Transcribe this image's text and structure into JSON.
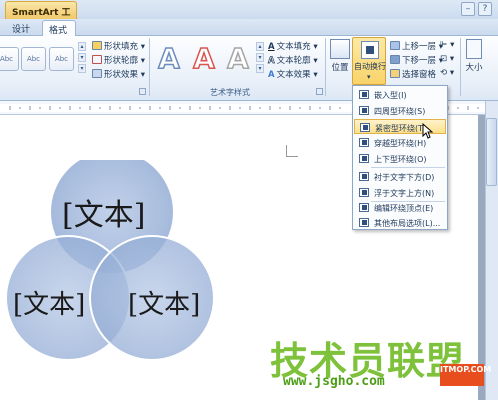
{
  "titlebar": {
    "context_tab": "SmartArt 工具"
  },
  "tabs": [
    {
      "label": "设计"
    },
    {
      "label": "格式"
    }
  ],
  "shape_styles": {
    "thumb_label": "Abc"
  },
  "shape_menu": [
    {
      "label": "形状填充",
      "arrow": "▾"
    },
    {
      "label": "形状轮廓",
      "arrow": "▾"
    },
    {
      "label": "形状效果",
      "arrow": "▾"
    }
  ],
  "wordart": {
    "glyph": "A",
    "group_label": "艺术字样式",
    "menu": [
      {
        "label": "文本填充",
        "arrow": "▾"
      },
      {
        "label": "文本轮廓",
        "arrow": "▾"
      },
      {
        "label": "文本效果",
        "arrow": "▾"
      }
    ]
  },
  "arrange": {
    "position_label": "位置",
    "wrap_label": "自动换行",
    "bring_forward": "上移一层",
    "send_backward": "下移一层",
    "selection_pane": "选择窗格",
    "size_label": "大小"
  },
  "wrap_menu": [
    {
      "label": "嵌入型(I)"
    },
    {
      "label": "四周型环绕(S)"
    },
    {
      "label": "紧密型环绕(T)"
    },
    {
      "label": "穿越型环绕(H)"
    },
    {
      "label": "上下型环绕(O)"
    },
    {
      "label": "衬于文字下方(D)"
    },
    {
      "label": "浮于文字上方(N)"
    },
    {
      "label": "编辑环绕顶点(E)"
    },
    {
      "label": "其他布局选项(L)..."
    }
  ],
  "venn": {
    "labels": [
      "[文本]",
      "[文本]",
      "[文本]"
    ]
  },
  "watermark": {
    "brand": "技术员联盟",
    "url": "www.jsgho.com",
    "badge": "ITMOP.COM"
  },
  "icons": [
    "close-icon",
    "minimize-icon",
    "help-icon",
    "text-fill-icon",
    "text-outline-icon",
    "text-effect-icon",
    "position-icon",
    "wrap-text-icon",
    "bring-forward-icon",
    "send-backward-icon",
    "selection-pane-icon",
    "size-icon",
    "mouse-cursor-icon"
  ],
  "colors": {
    "accent": "#f9d36a",
    "venn_fill": "#9db4d8",
    "watermark_green": "#7ec13a"
  }
}
